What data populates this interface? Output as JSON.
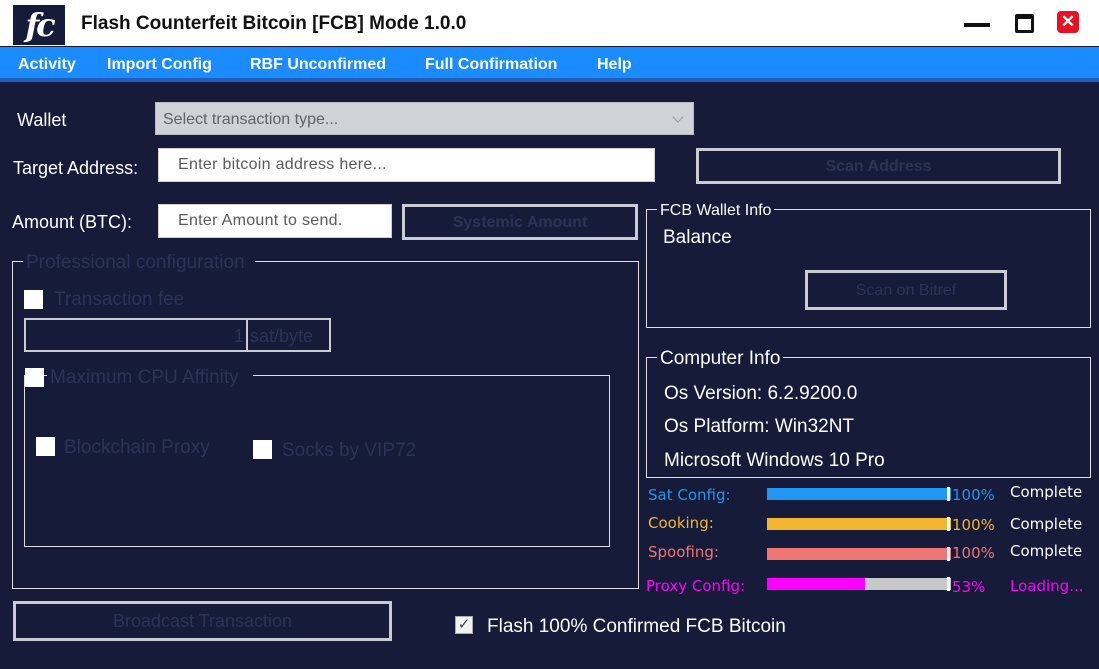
{
  "app": {
    "logo_text": "fc",
    "title": "Flash Counterfeit Bitcoin [FCB] Mode 1.0.0",
    "minimize_icon": "minimize-icon",
    "maximize_icon": "maximize-icon",
    "close_icon": "close-icon",
    "close_symbol": "✕"
  },
  "menu": {
    "items": [
      "Activity",
      "Import Config",
      "RBF Unconfirmed",
      "Full Confirmation",
      "Help"
    ]
  },
  "form": {
    "wallet_label": "Wallet",
    "wallet_placeholder": "Select transaction type...",
    "target_label": "Target Address:",
    "target_placeholder": "Enter bitcoin address here...",
    "scan_address_button": "Scan Address",
    "amount_label": "Amount (BTC):",
    "amount_placeholder": "Enter Amount to send.",
    "systemic_amount_button": "Systemic Amount"
  },
  "pro_config": {
    "title": "Professional configuration",
    "transaction_fee_label": "Transaction fee",
    "fee_value": "1",
    "fee_unit": "sat/byte",
    "max_cpu_label": "Maximum CPU Affinity",
    "blockchain_proxy_label": "Blockchain Proxy",
    "socks_label": "Socks by VIP72"
  },
  "wallet_info": {
    "title": "FCB Wallet Info",
    "balance_label": "Balance",
    "scan_button": "Scan on Bitref"
  },
  "computer_info": {
    "title": "Computer Info",
    "os_version": "Os Version: 6.2.9200.0",
    "os_platform": "Os Platform: Win32NT",
    "os_name": "Microsoft Windows 10 Pro"
  },
  "progress": [
    {
      "label": "Sat Config:",
      "percent": 100,
      "percent_text": "100%",
      "status": "Complete",
      "color": "#2196f3",
      "label_color": "#2196f3",
      "pct_color": "#2196f3",
      "status_color": "#ffffff"
    },
    {
      "label": "Cooking:",
      "percent": 100,
      "percent_text": "100%",
      "status": "Complete",
      "color": "#f4b531",
      "label_color": "#f4b531",
      "pct_color": "#f4b531",
      "status_color": "#ffffff"
    },
    {
      "label": "Spoofing:",
      "percent": 100,
      "percent_text": "100%",
      "status": "Complete",
      "color": "#f07474",
      "label_color": "#f07474",
      "pct_color": "#f07474",
      "status_color": "#ffffff"
    },
    {
      "label": "Proxy Config:",
      "percent": 53,
      "percent_text": "53%",
      "status": "Loading...",
      "color": "#ff00ff",
      "label_color": "#ff00ff",
      "pct_color": "#ff00ff",
      "status_color": "#ff00ff"
    }
  ],
  "actions": {
    "broadcast_button": "Broadcast Transaction",
    "flash_checkbox_label": "Flash 100% Confirmed FCB Bitcoin",
    "flash_checked": true,
    "check_symbol": "✓"
  },
  "colors": {
    "background": "#151b38",
    "menubar": "#1a8cff",
    "disabled_text": "#2b3458",
    "close_button": "#e81123"
  }
}
